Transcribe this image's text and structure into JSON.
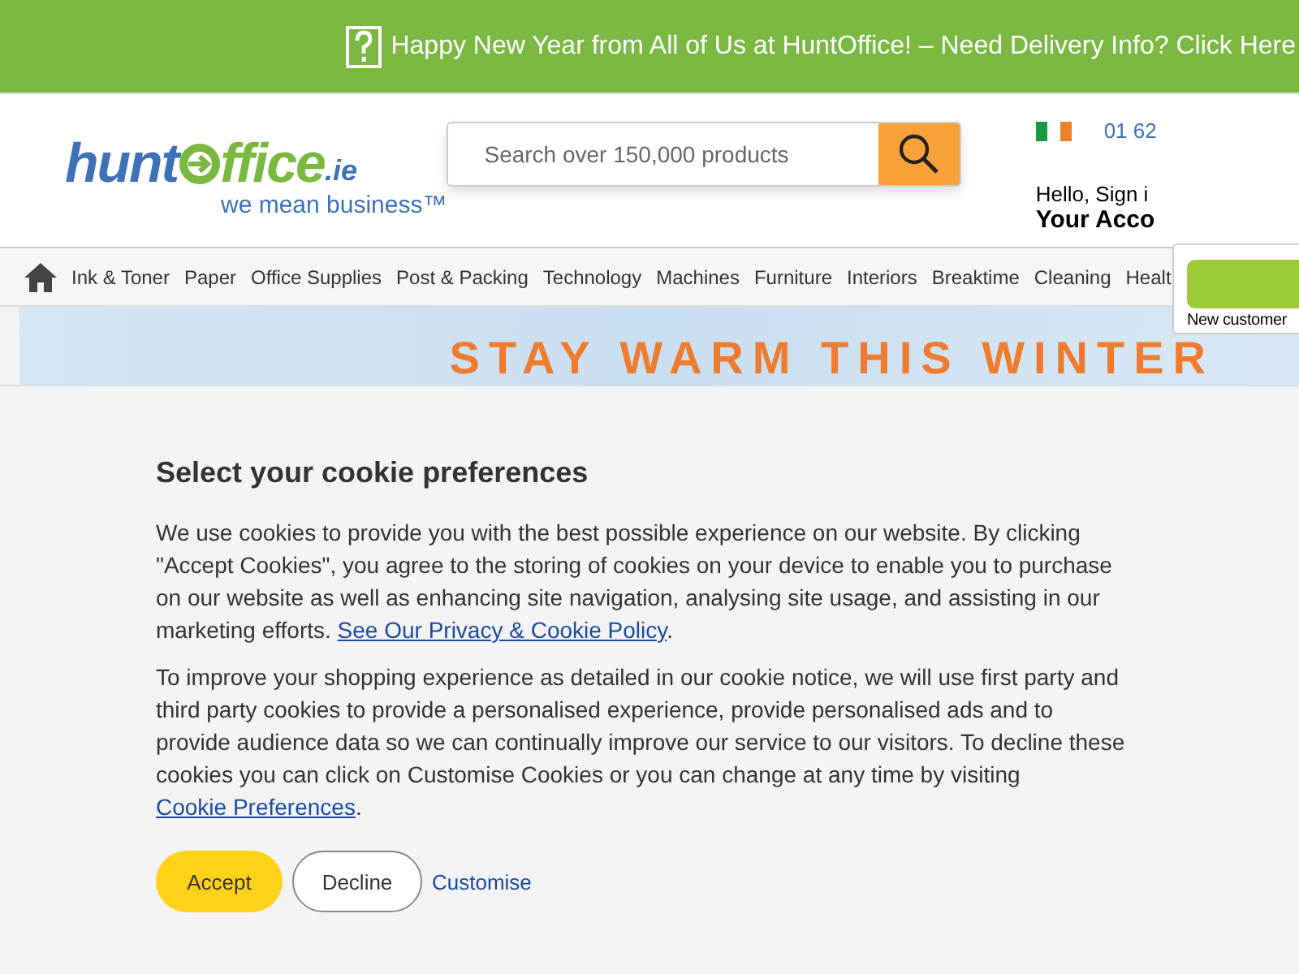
{
  "banner": {
    "text": "Happy New Year from All of Us at HuntOffice! – Need Delivery Info? Click Here"
  },
  "logo": {
    "first": "hunt",
    "second": "ffice",
    "suffix": ".ie",
    "tagline": "we mean business™"
  },
  "search": {
    "placeholder": "Search over 150,000 products"
  },
  "contact": {
    "phone": "01 62"
  },
  "account": {
    "greeting": "Hello, Sign i",
    "title": "Your Acco",
    "new_customer": "New customer"
  },
  "nav": [
    "Ink & Toner",
    "Paper",
    "Office Supplies",
    "Post & Packing",
    "Technology",
    "Machines",
    "Furniture",
    "Interiors",
    "Breaktime",
    "Cleaning",
    "Healt"
  ],
  "hero": {
    "title": "STAY WARM THIS WINTER"
  },
  "cookie": {
    "title": "Select your cookie preferences",
    "paragraphs": [
      {
        "before": "We use cookies to provide you with the best possible experience on our website. By clicking \"Accept Cookies\", you agree to the storing of cookies on your device to enable you to purchase on our website as well as enhancing site navigation, analysing site usage, and assisting in our marketing efforts. ",
        "link": "See Our Privacy & Cookie Policy",
        "after": "."
      },
      {
        "before": "To improve your shopping experience as detailed in our cookie notice, we will use first party and third party cookies to provide a personalised experience, provide personalised ads and to provide audience data so we can continually improve our service to our visitors. To decline these cookies you can click on Customise Cookies or you can change at any time by visiting ",
        "link": "Cookie Preferences",
        "after": "."
      }
    ],
    "buttons": [
      {
        "label": "Accept",
        "kind": "primary"
      },
      {
        "label": "Decline",
        "kind": "outline"
      },
      {
        "label": "Customise",
        "kind": "link"
      }
    ]
  }
}
